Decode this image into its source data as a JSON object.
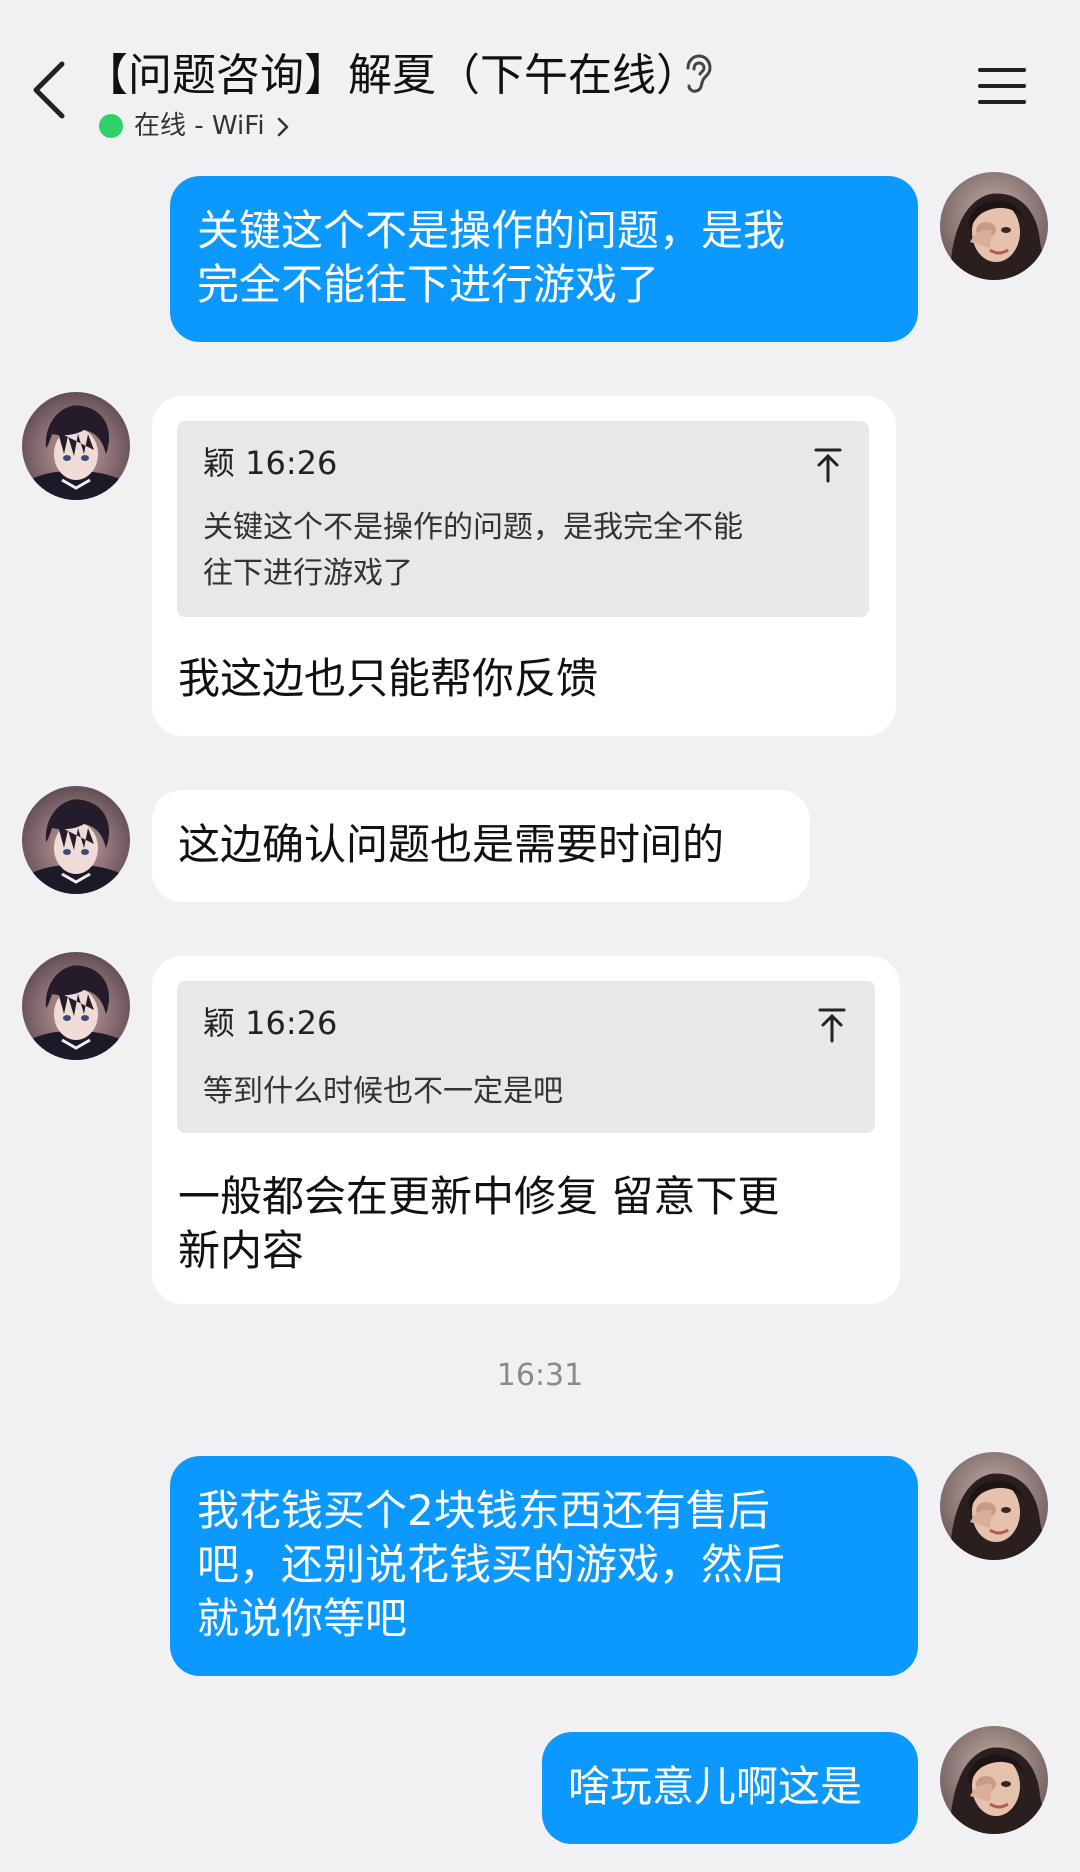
{
  "header": {
    "title": "【问题咨询】解夏（下午在线）",
    "status": "在线 - WiFi",
    "status_color": "#2fd16b",
    "icons": [
      "back-icon",
      "ear-icon",
      "chevron-right-icon",
      "menu-icon"
    ]
  },
  "colors": {
    "my_bubble": "#0b99ff",
    "their_bubble": "#ffffff",
    "background": "#f1f1f4",
    "quote_background": "#e8e8e8"
  },
  "messages": {
    "m1": {
      "sender": "me",
      "line1": "关键这个不是操作的问题，是我",
      "line2": "完全不能往下进行游戏了"
    },
    "m2": {
      "sender": "them",
      "quote_author_time": "颖 16:26",
      "quote_line1": "关键这个不是操作的问题，是我完全不能",
      "quote_line2": "往下进行游戏了",
      "text": "我这边也只能帮你反馈"
    },
    "m3": {
      "sender": "them",
      "text": "这边确认问题也是需要时间的"
    },
    "m4": {
      "sender": "them",
      "quote_author_time": "颖 16:26",
      "quote_line1": "等到什么时候也不一定是吧",
      "line1": "一般都会在更新中修复 留意下更",
      "line2": "新内容"
    },
    "timestamp": "16:31",
    "m5": {
      "sender": "me",
      "line1": "我花钱买个2块钱东西还有售后",
      "line2": "吧，还别说花钱买的游戏，然后",
      "line3": "就说你等吧"
    },
    "m6": {
      "sender": "me",
      "text": "啥玩意儿啊这是"
    }
  }
}
